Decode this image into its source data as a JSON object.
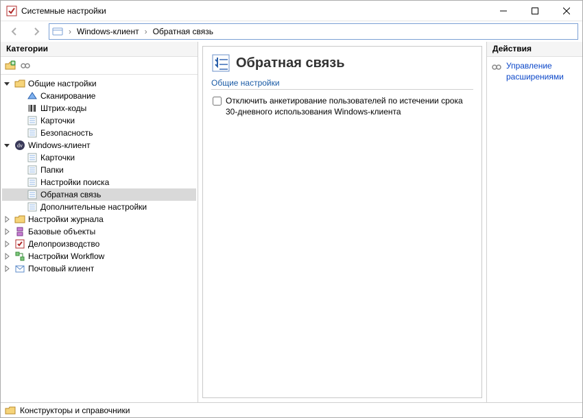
{
  "window": {
    "title": "Системные настройки"
  },
  "breadcrumb": {
    "items": [
      "Windows-клиент",
      "Обратная связь"
    ]
  },
  "sidebar": {
    "header": "Категории",
    "tree": [
      {
        "label": "Общие настройки",
        "icon": "folder",
        "depth": 0,
        "expander": "open"
      },
      {
        "label": "Сканирование",
        "icon": "scan",
        "depth": 1,
        "expander": "none"
      },
      {
        "label": "Штрих-коды",
        "icon": "barcode",
        "depth": 1,
        "expander": "none"
      },
      {
        "label": "Карточки",
        "icon": "form",
        "depth": 1,
        "expander": "none"
      },
      {
        "label": "Безопасность",
        "icon": "form",
        "depth": 1,
        "expander": "none"
      },
      {
        "label": "Windows-клиент",
        "icon": "dv",
        "depth": 0,
        "expander": "open"
      },
      {
        "label": "Карточки",
        "icon": "form",
        "depth": 1,
        "expander": "none"
      },
      {
        "label": "Папки",
        "icon": "form",
        "depth": 1,
        "expander": "none"
      },
      {
        "label": "Настройки поиска",
        "icon": "form",
        "depth": 1,
        "expander": "none"
      },
      {
        "label": "Обратная связь",
        "icon": "form",
        "depth": 1,
        "expander": "none",
        "selected": true
      },
      {
        "label": "Дополнительные настройки",
        "icon": "form",
        "depth": 1,
        "expander": "none"
      },
      {
        "label": "Настройки журнала",
        "icon": "folder",
        "depth": 0,
        "expander": "closed"
      },
      {
        "label": "Базовые объекты",
        "icon": "base",
        "depth": 0,
        "expander": "closed"
      },
      {
        "label": "Делопроизводство",
        "icon": "case",
        "depth": 0,
        "expander": "closed"
      },
      {
        "label": "Настройки Workflow",
        "icon": "workflow",
        "depth": 0,
        "expander": "closed"
      },
      {
        "label": "Почтовый клиент",
        "icon": "mail",
        "depth": 0,
        "expander": "closed"
      }
    ]
  },
  "content": {
    "title": "Обратная связь",
    "group_title": "Общие настройки",
    "checkbox_label": "Отключить анкетирование пользователей по истечении срока 30-дневного использования Windows-клиента",
    "checkbox_checked": false
  },
  "actions": {
    "header": "Действия",
    "manage_link": "Управление расширениями"
  },
  "statusbar": {
    "text": "Конструкторы и справочники"
  }
}
